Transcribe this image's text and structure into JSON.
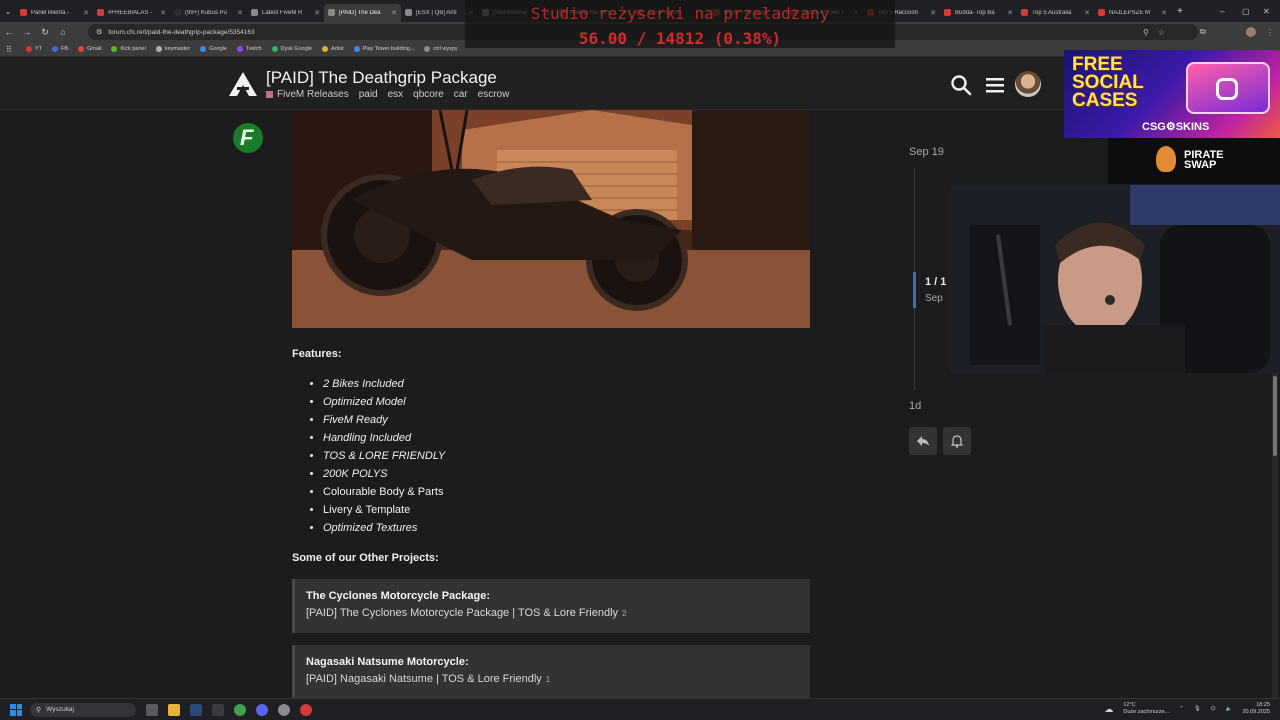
{
  "browser": {
    "tabs": [
      {
        "title": "Panel klienta -",
        "color": "#d33a3a"
      },
      {
        "title": "#FREEBIALAS -",
        "color": "#d33a3a"
      },
      {
        "title": "(99+) Kubuś Pu",
        "color": "#2c2c2c"
      },
      {
        "title": "Latest FiveM R",
        "color": "#8a8a8a"
      },
      {
        "title": "[PAID] The Dea",
        "color": "#8a8a8a",
        "active": true
      },
      {
        "title": "[ESX | QB] Anti",
        "color": "#8a8a8a"
      },
      {
        "title": "[Standalone]",
        "color": "#8a8a8a"
      },
      {
        "title": "Pokoja Na SEV",
        "color": "#d33a3a"
      },
      {
        "title": "Top 5 Robot",
        "color": "#d33a3a"
      },
      {
        "title": "DZIKI TRENER",
        "color": "#d33a3a"
      },
      {
        "title": "1SCOUP Twin T",
        "color": "#d33a3a"
      },
      {
        "title": "Top 5 Raccoon",
        "color": "#d33a3a"
      },
      {
        "title": "Budda- Top Ba",
        "color": "#d33a3a"
      },
      {
        "title": "Top 5 Australia",
        "color": "#d33a3a"
      },
      {
        "title": "NAJLEPSZE M",
        "color": "#d33a3a"
      }
    ],
    "url": "forum.cfx.re/t/paid-the-deathgrip-package/5354163",
    "bookmarks": [
      {
        "label": "YT",
        "color": "#d33a3a"
      },
      {
        "label": "FB",
        "color": "#3b6bd8"
      },
      {
        "label": "Gmail",
        "color": "#e04a3a"
      },
      {
        "label": "Kick panel",
        "color": "#53c02a"
      },
      {
        "label": "keymaster",
        "color": "#b0b0b0"
      },
      {
        "label": "Google",
        "color": "#3b8be8"
      },
      {
        "label": "Twitch",
        "color": "#9146ff"
      },
      {
        "label": "Dysk Google",
        "color": "#2fb36a"
      },
      {
        "label": "Artist",
        "color": "#d7b640"
      },
      {
        "label": "Play Tower building...",
        "color": "#3b8be8"
      },
      {
        "label": "ctrl wyspy",
        "color": "#8a8a8a"
      }
    ]
  },
  "overlay": {
    "line1": "Studio reżyserki na przeładzany",
    "line2": "56.00 / 14812 (0.38%)"
  },
  "forum": {
    "title": "[PAID] The Deathgrip Package",
    "category": "FiveM Releases",
    "tags": [
      "paid",
      "esx",
      "qbcore",
      "car",
      "escrow"
    ]
  },
  "ads": {
    "top_line1": "FREE",
    "top_line2": "SOCIAL",
    "top_line3": "CASES",
    "top_brand": "CSG⚙SKINS",
    "bottom_line1": "PIRATE",
    "bottom_line2": "SWAP"
  },
  "post": {
    "features_heading": "Features:",
    "features": [
      {
        "text": "2 Bikes Included",
        "italic": true
      },
      {
        "text": "Optimized Model",
        "italic": true
      },
      {
        "text": "FiveM Ready",
        "italic": true
      },
      {
        "text": "Handling Included",
        "italic": true
      },
      {
        "text": "TOS & LORE FRIENDLY",
        "italic": true
      },
      {
        "text": "200K POLYS",
        "italic": true
      },
      {
        "text": "Colourable Body & Parts",
        "italic": false
      },
      {
        "text": "Livery & Template",
        "italic": false
      },
      {
        "text": "Optimized Textures",
        "italic": true
      }
    ],
    "other_heading": "Some of our Other Projects:",
    "oneboxes": [
      {
        "title": "The Cyclones Motorcycle Package:",
        "link": "[PAID] The Cyclones Motorcycle Package | TOS & Lore Friendly",
        "count": "2"
      },
      {
        "title": "Nagasaki Natsume Motorcycle:",
        "link": "[PAID] Nagasaki Natsume | TOS & Lore Friendly",
        "count": "1"
      }
    ]
  },
  "timeline": {
    "top_date": "Sep 19",
    "position": "1 / 1",
    "position_date": "Sep",
    "bottom": "1d"
  },
  "taskbar": {
    "search_placeholder": "Wyszukaj",
    "weather_temp": "12°C",
    "weather_desc": "Duże zachmurze...",
    "time": "18:25",
    "date": "20.09.2025"
  }
}
